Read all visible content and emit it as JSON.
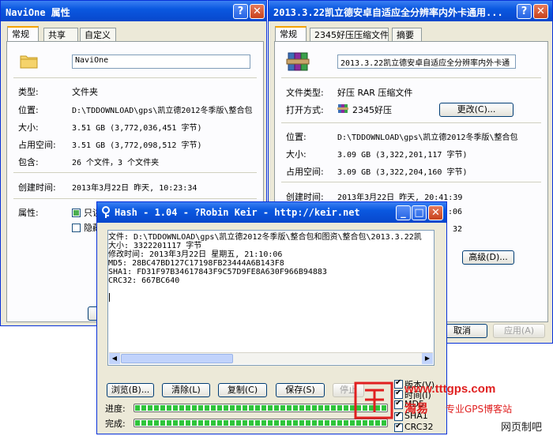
{
  "win1": {
    "title": "NaviOne 属性",
    "tabs": [
      "常规",
      "共享",
      "自定义"
    ],
    "name_value": "NaviOne",
    "rows": [
      {
        "label": "类型:",
        "value": "文件夹"
      },
      {
        "label": "位置:",
        "value": "D:\\TDDOWNLOAD\\gps\\凯立德2012冬季版\\整合包"
      },
      {
        "label": "大小:",
        "value": "3.51 GB (3,772,036,451 字节)"
      },
      {
        "label": "占用空间:",
        "value": "3.51 GB (3,772,098,512 字节)"
      },
      {
        "label": "包含:",
        "value": "26 个文件，3 个文件夹"
      },
      {
        "label": "创建时间:",
        "value": "2013年3月22日 昨天, 10:23:34"
      },
      {
        "label": "属性:",
        "value": ""
      }
    ],
    "attr_readonly": "只读",
    "attr_hidden": "隐藏"
  },
  "win2": {
    "title": "2013.3.22凯立德安卓自适应全分辨率内外卡通用...",
    "tabs": [
      "常规",
      "2345好压压缩文件",
      "摘要"
    ],
    "name_value": "2013.3.22凯立德安卓自适应全分辨率内外卡通",
    "type_label": "文件类型:",
    "type_value": "好压 RAR 压缩文件",
    "open_label": "打开方式:",
    "open_value": "2345好压",
    "change_button": "更改(C)...",
    "rows": [
      {
        "label": "位置:",
        "value": "D:\\TDDOWNLOAD\\gps\\凯立德2012冬季版\\整合包"
      },
      {
        "label": "大小:",
        "value": "3.09 GB (3,322,201,117 字节)"
      },
      {
        "label": "占用空间:",
        "value": "3.09 GB (3,322,204,160 字节)"
      },
      {
        "label": "创建时间:",
        "value": "2013年3月22日 昨天, 20:41:39"
      }
    ],
    "partial_time1": ":06",
    "partial_time2": "32",
    "advanced_button": "高级(D)...",
    "cancel_button": "取消",
    "apply_button": "应用(A)"
  },
  "hash": {
    "title": "Hash - 1.04 - ?Robin Keir - http://keir.net",
    "lines": [
      "文件: D:\\TDDOWNLOAD\\gps\\凯立德2012冬季版\\整合包和图资\\整合包\\2013.3.22凯",
      "大小: 3322201117 字节",
      "修改时间: 2013年3月22日 星期五, 21:10:06",
      "MD5: 28BC47BD127C17198FB23444A6B143F8",
      "SHA1: FD31F97B34617843F9C57D9FE8A630F966B94883",
      "CRC32: 667BC640"
    ],
    "browse_button": "浏览(B)...",
    "clear_button": "清除(L)",
    "copy_button": "复制(C)",
    "save_button": "保存(S)",
    "stop_button": "停止",
    "progress_label": "进度:",
    "complete_label": "完成:",
    "progress_value": 1.0,
    "complete_value": 1.0,
    "options": [
      {
        "label": "版本(V)",
        "checked": true
      },
      {
        "label": "时间(I)",
        "checked": true
      },
      {
        "label": "MD5",
        "checked": true
      },
      {
        "label": "SHA1",
        "checked": true
      },
      {
        "label": "CRC32",
        "checked": true
      }
    ]
  },
  "watermark": {
    "url": "www.tttgps.com",
    "brand": "淘易",
    "tagline": "专业GPS博客站",
    "corner": "网页制吧"
  }
}
